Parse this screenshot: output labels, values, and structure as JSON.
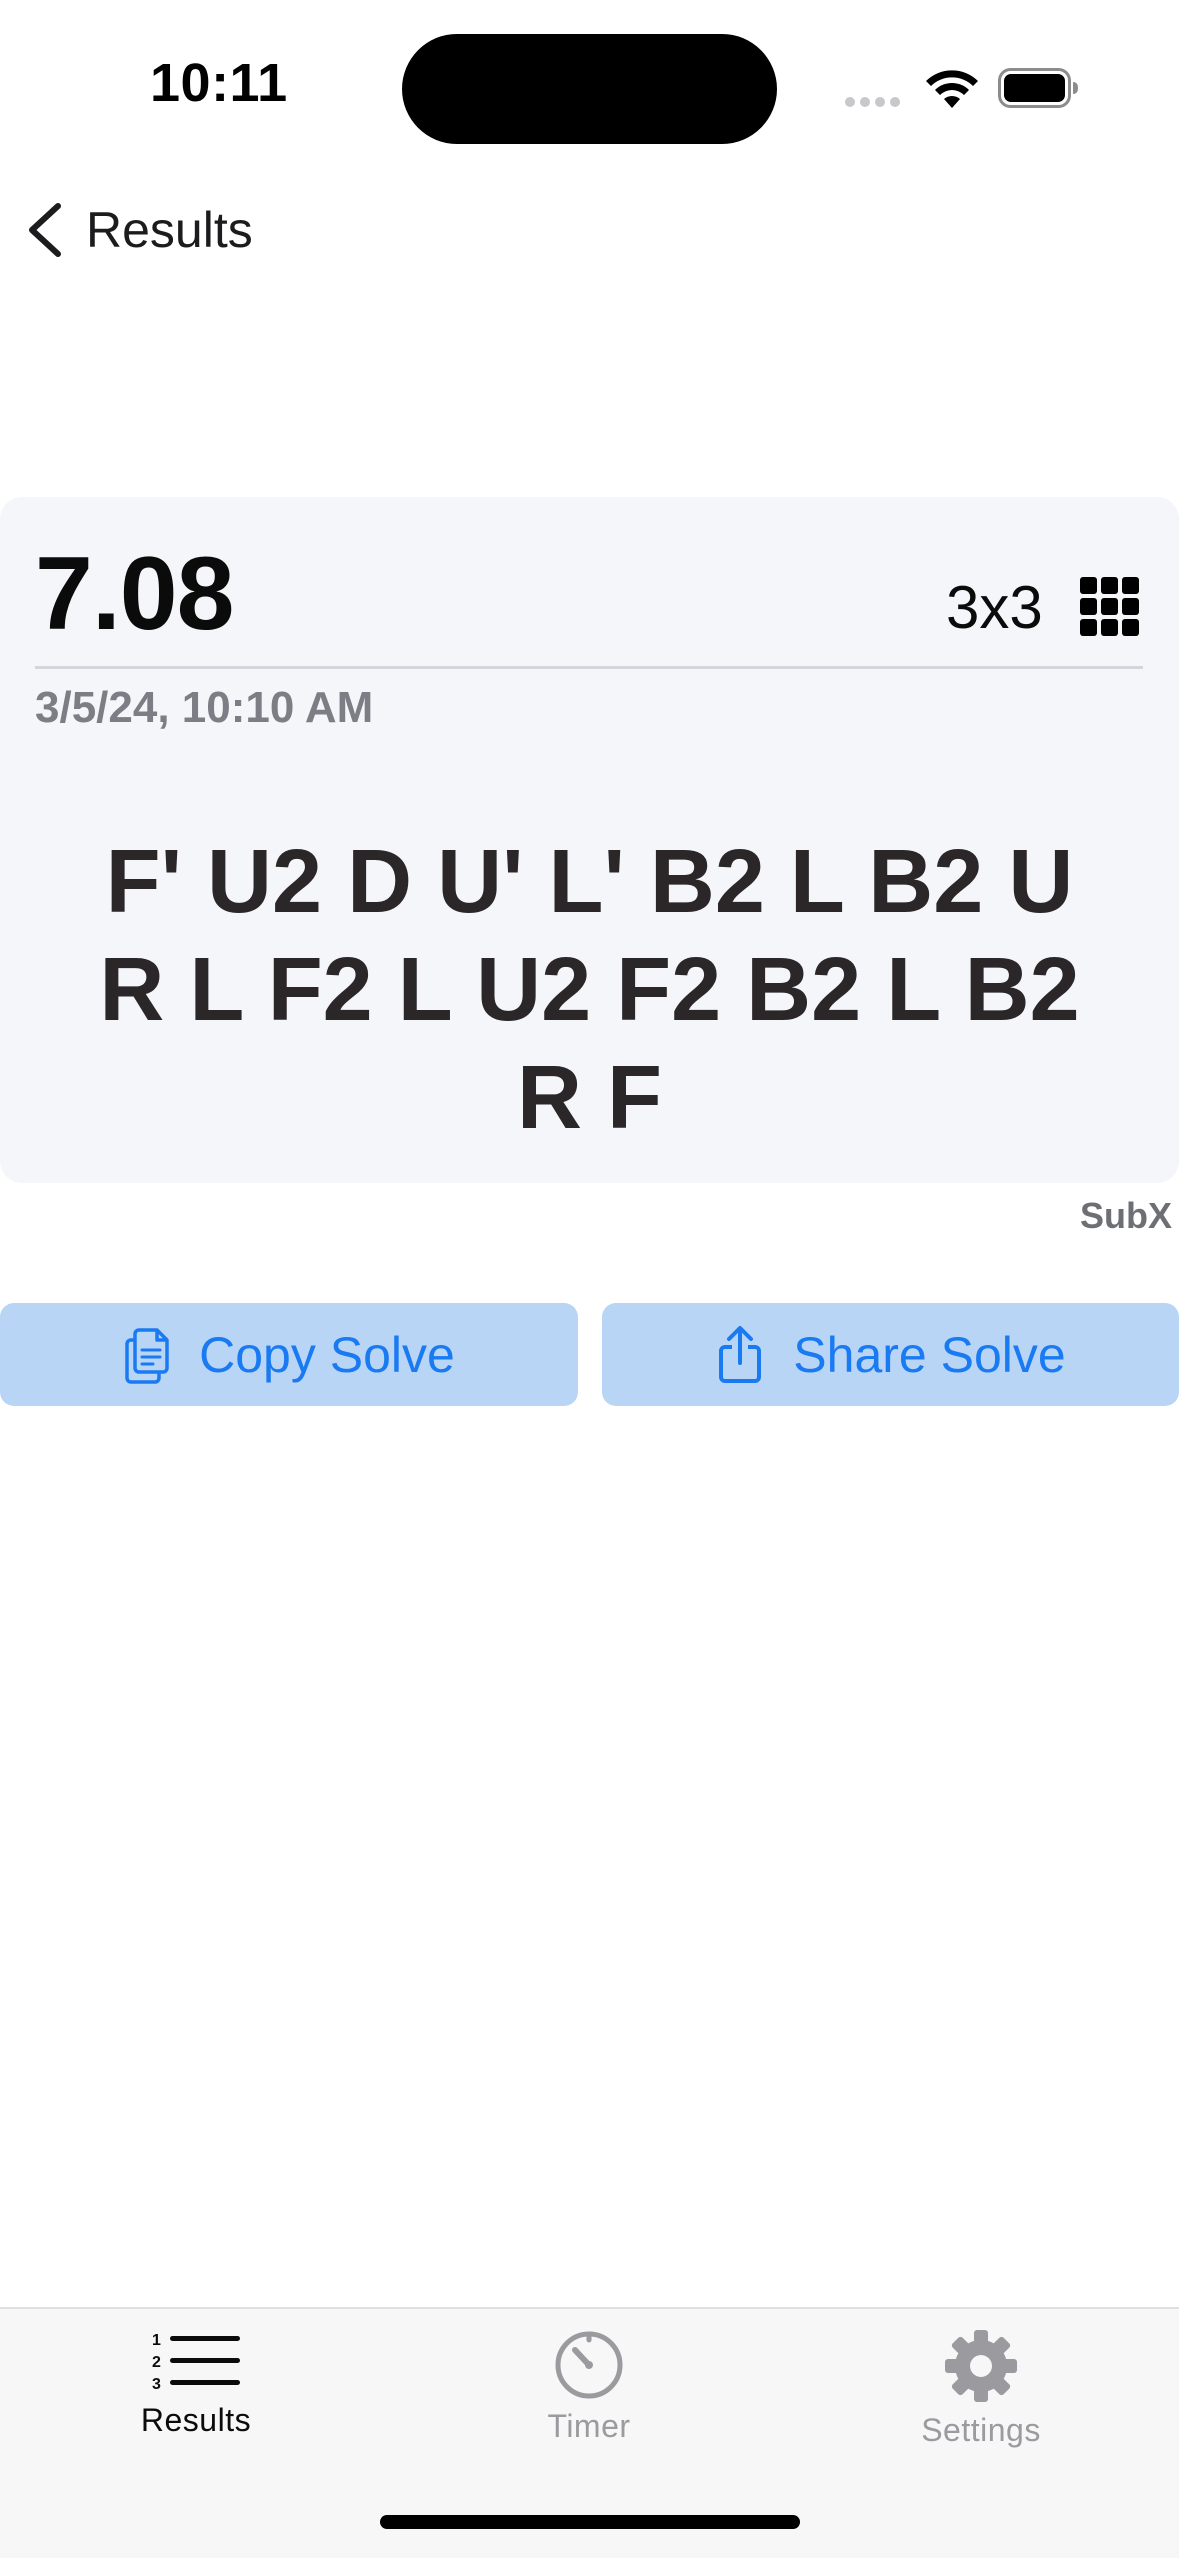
{
  "status_bar": {
    "time": "10:11"
  },
  "nav": {
    "back_label": "Results"
  },
  "solve": {
    "time": "7.08",
    "puzzle_type": "3x3",
    "puzzle_icon": "grid-3x3-icon",
    "date": "3/5/24, 10:10 AM",
    "scramble": "F' U2 D U' L' B2 L B2 U R L F2 L U2 F2 B2 L B2 R F",
    "session": "SubX"
  },
  "actions": {
    "copy_label": "Copy Solve",
    "copy_icon": "copy-icon",
    "share_label": "Share Solve",
    "share_icon": "share-icon"
  },
  "tab_bar": {
    "tabs": [
      {
        "label": "Results",
        "icon": "numbered-list-icon",
        "selected": true
      },
      {
        "label": "Timer",
        "icon": "timer-icon",
        "selected": false
      },
      {
        "label": "Settings",
        "icon": "gear-icon",
        "selected": false
      }
    ]
  },
  "colors": {
    "accent": "#1a7af2",
    "button_bg": "#b8d5f5",
    "card_bg": "#f5f6fa",
    "inactive_tab": "#9a9a9f"
  }
}
